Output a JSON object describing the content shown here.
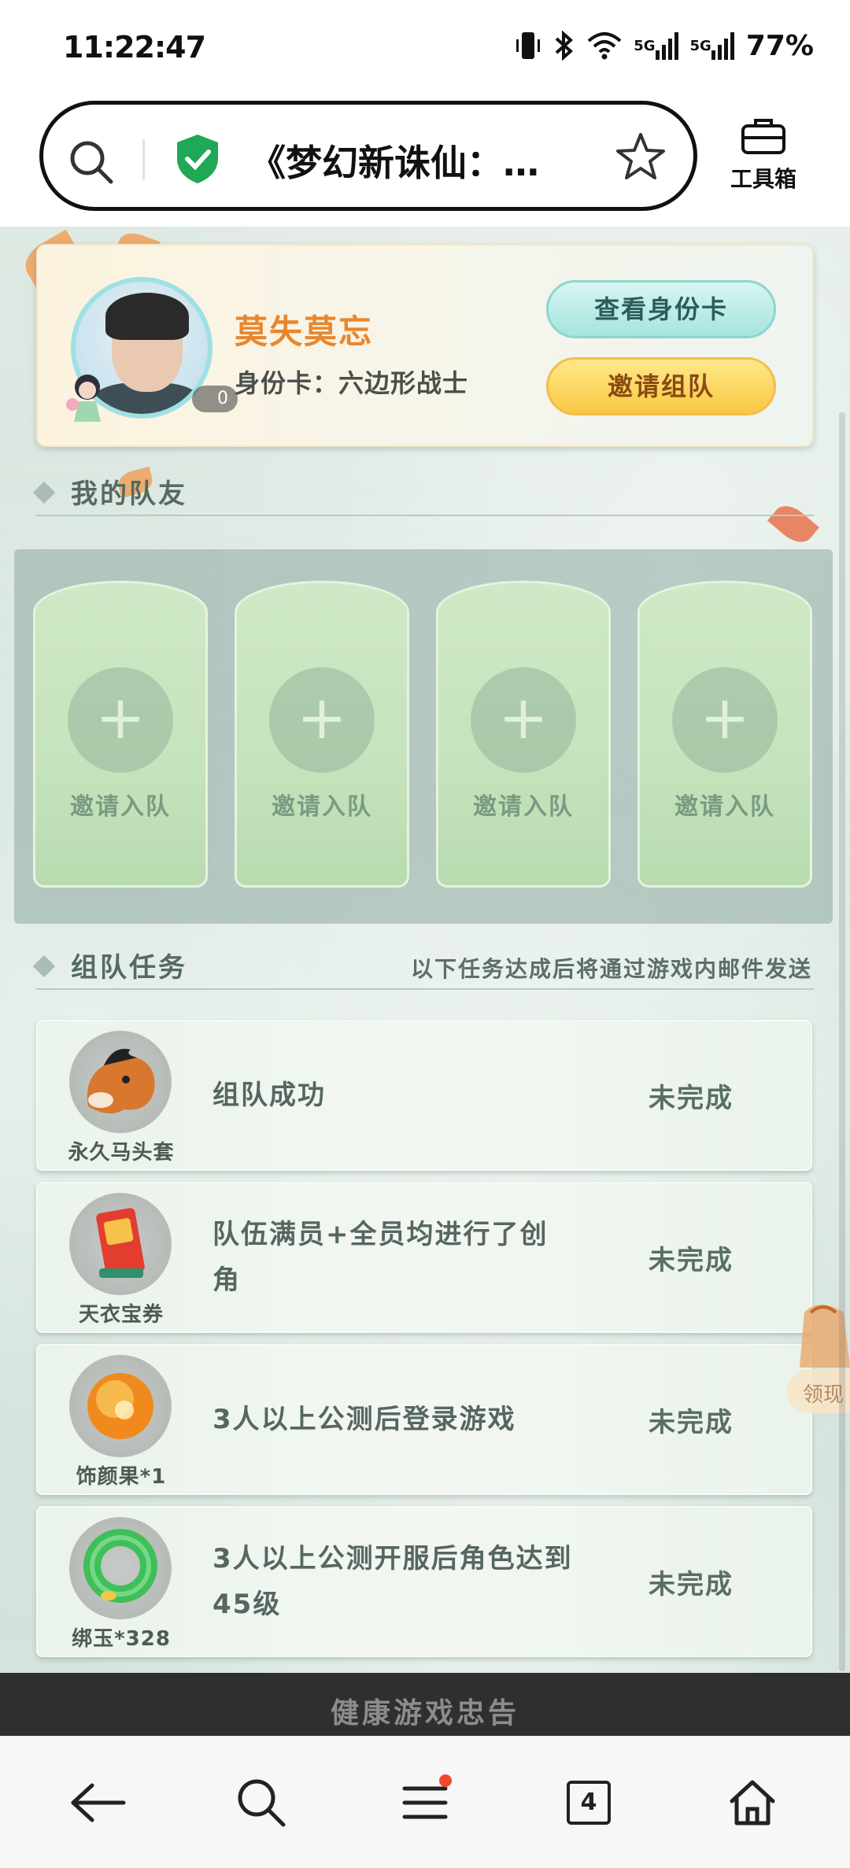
{
  "status_bar": {
    "time": "11:22:47",
    "signal_1": "5G",
    "signal_2": "5G",
    "battery": "77%",
    "icons": [
      "vibrate-icon",
      "bluetooth-icon",
      "wifi-icon",
      "signal-icon",
      "signal-icon"
    ]
  },
  "address_bar": {
    "title": "《梦幻新诛仙：…",
    "toolbox_label": "工具箱"
  },
  "profile": {
    "name": "莫失莫忘",
    "id_card": "身份卡：六边形战士",
    "badge_count": "0",
    "view_card_button": "查看身份卡",
    "invite_team_button": "邀请组队"
  },
  "teammates": {
    "title": "我的队友",
    "slots": [
      {
        "label": "邀请入队"
      },
      {
        "label": "邀请入队"
      },
      {
        "label": "邀请入队"
      },
      {
        "label": "邀请入队"
      }
    ]
  },
  "tasks": {
    "title": "组队任务",
    "note": "以下任务达成后将通过游戏内邮件发送",
    "items": [
      {
        "reward": "永久马头套",
        "desc": "组队成功",
        "status": "未完成"
      },
      {
        "reward": "天衣宝券",
        "desc": "队伍满员+全员均进行了创角",
        "status": "未完成"
      },
      {
        "reward": "饰颜果*1",
        "desc": "3人以上公测后登录游戏",
        "status": "未完成"
      },
      {
        "reward": "绑玉*328",
        "desc": "3人以上公测开服后角色达到45级",
        "status": "未完成"
      }
    ]
  },
  "floating": {
    "label": "领现"
  },
  "footer": {
    "health_notice": "健康游戏忠告"
  },
  "bottom_nav": {
    "tab_count": "4"
  },
  "colors": {
    "name_orange": "#e9862c",
    "button_teal": "#a5e5df",
    "button_gold": "#f9c843",
    "page_bg": "#d6e5de"
  }
}
